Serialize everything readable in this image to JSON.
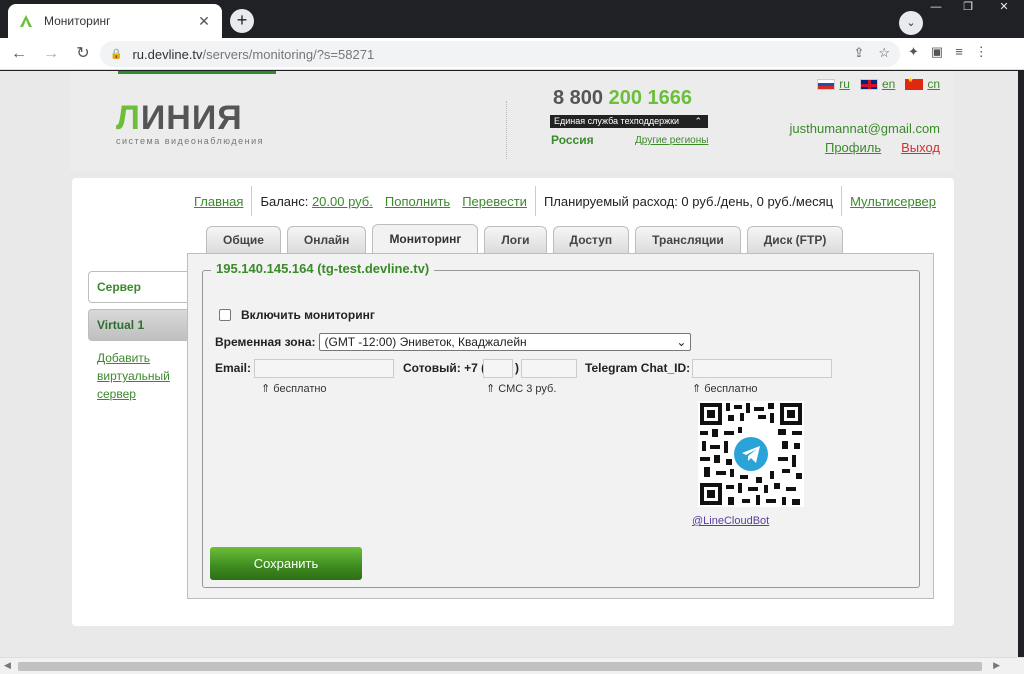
{
  "browser": {
    "tab_title": "Мониторинг",
    "url_host": "ru.devline.tv",
    "url_path": "/servers/monitoring/?s=58271",
    "new_tab_symbol": "+",
    "close_symbol": "✕",
    "icons": [
      "back-icon",
      "forward-icon",
      "reload-icon",
      "lock-icon",
      "share-icon",
      "star-icon",
      "extensions-icon",
      "sidepanel-icon",
      "menu-icon"
    ]
  },
  "header": {
    "logo_text_1": "Л",
    "logo_text_2": "ИНИЯ",
    "logo_sub": "система видеонаблюдения",
    "phone_prefix": "8 800",
    "phone_green": "200 1666",
    "support_label": "Единая служба техподдержки",
    "region": "Россия",
    "other_regions": "Другие регионы",
    "langs": [
      {
        "code": "ru",
        "label": "ru"
      },
      {
        "code": "en",
        "label": "en"
      },
      {
        "code": "cn",
        "label": "cn"
      }
    ],
    "email": "justhumannat@gmail.com",
    "profile": "Профиль",
    "logout": "Выход"
  },
  "infobar": {
    "home": "Главная",
    "balance_label": "Баланс:",
    "balance_value": "20.00 руб.",
    "topup": "Пополнить",
    "transfer": "Перевести",
    "planned": "Планируемый расход: 0 руб./день, 0 руб./месяц",
    "multiserver": "Мультисервер"
  },
  "tabs": [
    "Общие",
    "Онлайн",
    "Мониторинг",
    "Логи",
    "Доступ",
    "Трансляции",
    "Диск (FTP)"
  ],
  "active_tab": "Мониторинг",
  "sidenav": {
    "server": "Сервер",
    "virtual": "Virtual 1",
    "add_virtual": "Добавить виртуальный сервер"
  },
  "monitoring": {
    "legend": "195.140.145.164 (tg-test.devline.tv)",
    "enable_label": "Включить мониторинг",
    "enabled": false,
    "tz_label": "Временная зона:",
    "tz_value": "(GMT -12:00) Эниветок, Кваджалейн",
    "email_label": "Email:",
    "email_value": "",
    "phone_label": "Сотовый: +7 (",
    "phone_close": ")",
    "telegram_label": "Telegram Chat_ID:",
    "hint_email": "⇑ бесплатно",
    "hint_sms": "⇑ СМС 3 руб.",
    "hint_telegram": "⇑ бесплатно",
    "bot_link": "@LineCloudBot",
    "save_button": "Сохранить"
  },
  "colors": {
    "brand_green": "#6cbf3a",
    "link_green": "#3a8a2a",
    "logout_red": "#d32f2f"
  }
}
